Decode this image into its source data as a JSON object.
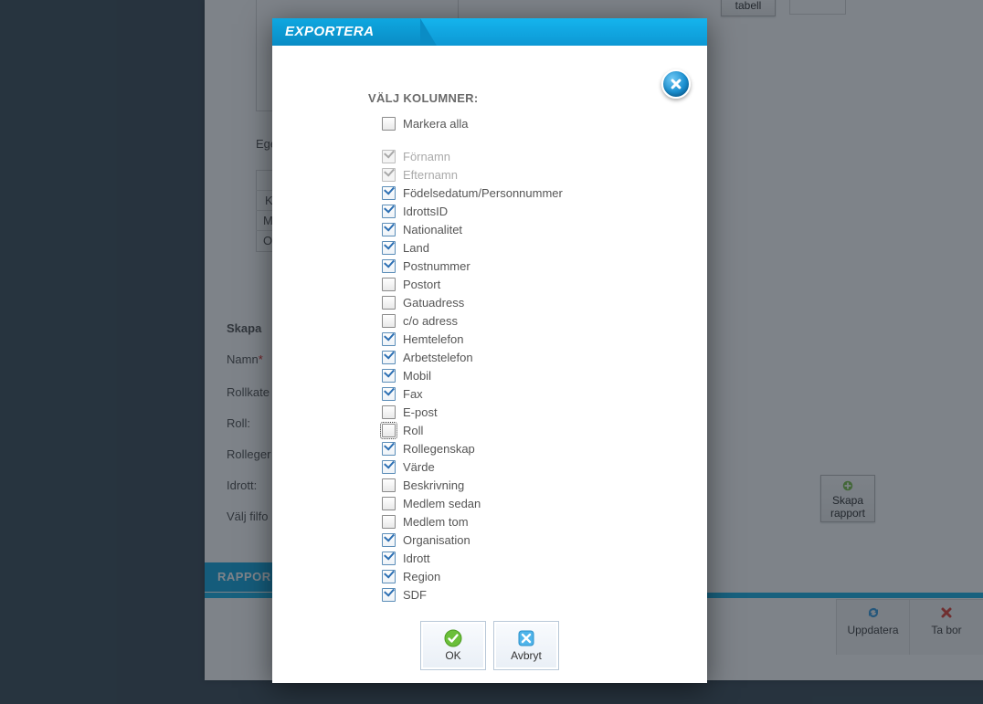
{
  "modal": {
    "title": "EXPORTERA",
    "close_icon": "close",
    "section_title": "VÄLJ KOLUMNER:",
    "select_all": {
      "label": "Markera alla",
      "checked": false
    },
    "columns": [
      {
        "label": "Förnamn",
        "checked": true,
        "disabled": true
      },
      {
        "label": "Efternamn",
        "checked": true,
        "disabled": true
      },
      {
        "label": "Födelsedatum/Personnummer",
        "checked": true
      },
      {
        "label": "IdrottsID",
        "checked": true
      },
      {
        "label": "Nationalitet",
        "checked": true
      },
      {
        "label": "Land",
        "checked": true
      },
      {
        "label": "Postnummer",
        "checked": true
      },
      {
        "label": "Postort",
        "checked": false
      },
      {
        "label": "Gatuadress",
        "checked": false
      },
      {
        "label": "c/o adress",
        "checked": false
      },
      {
        "label": "Hemtelefon",
        "checked": true
      },
      {
        "label": "Arbetstelefon",
        "checked": true
      },
      {
        "label": "Mobil",
        "checked": true
      },
      {
        "label": "Fax",
        "checked": true
      },
      {
        "label": "E-post",
        "checked": false
      },
      {
        "label": "Roll",
        "checked": false,
        "focused": true
      },
      {
        "label": "Rollegenskap",
        "checked": true
      },
      {
        "label": "Värde",
        "checked": true
      },
      {
        "label": "Beskrivning",
        "checked": false
      },
      {
        "label": "Medlem sedan",
        "checked": false
      },
      {
        "label": "Medlem tom",
        "checked": false
      },
      {
        "label": "Organisation",
        "checked": true
      },
      {
        "label": "Idrott",
        "checked": true
      },
      {
        "label": "Region",
        "checked": true
      },
      {
        "label": "SDF",
        "checked": true
      }
    ],
    "buttons": {
      "ok": "OK",
      "cancel": "Avbryt"
    }
  },
  "background": {
    "tabell_button": "tabell",
    "egen_label": "Eger",
    "table_rows": [
      "K",
      "M",
      "O"
    ],
    "skapa_heading": "Skapa",
    "namn_label": "Namn",
    "rollkat_label": "Rollkate",
    "roll_label": "Roll:",
    "rolleger_label": "Rolleger",
    "idrott_label": "Idrott:",
    "valj_filfo_label": "Välj filfo",
    "rapport_tab": "RAPPOR",
    "skapa_rapport_button": "Skapa\nrapport",
    "uppdatera_button": "Uppdatera",
    "ta_bort_button": "Ta bor"
  }
}
